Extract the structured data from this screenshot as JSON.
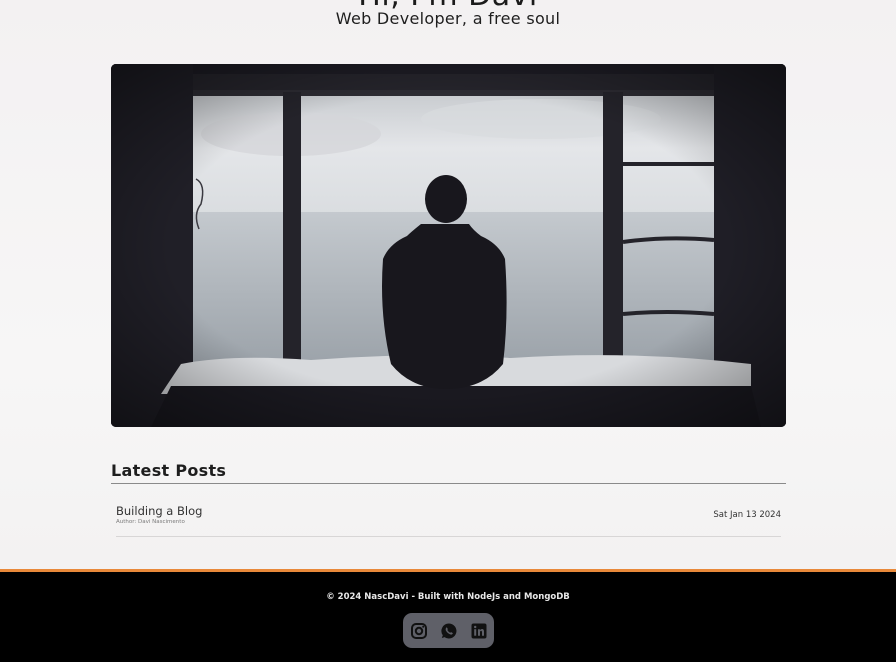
{
  "hero": {
    "title": "Hi, I'm Davi",
    "subtitle": "Web Developer, a free soul"
  },
  "latest": {
    "heading": "Latest Posts",
    "posts": [
      {
        "title": "Building a Blog",
        "author": "Author: Davi Nascimento",
        "date": "Sat Jan 13 2024"
      }
    ]
  },
  "footer": {
    "text": "© 2024 NascDavi - Built with NodeJs and MongoDB",
    "accent_color": "#e8893a",
    "social_icons": [
      "instagram-icon",
      "whatsapp-icon",
      "linkedin-icon"
    ]
  }
}
